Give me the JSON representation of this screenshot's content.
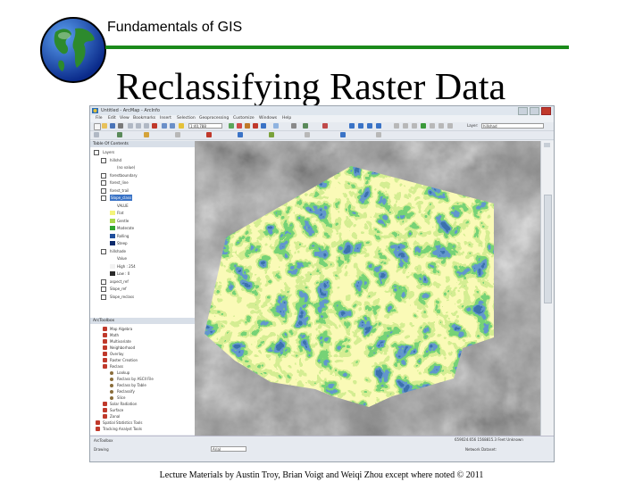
{
  "slide": {
    "course": "Fundamentals of GIS",
    "title": "Reclassifying Raster Data",
    "footer": "Lecture Materials by Austin Troy, Brian Voigt and Weiqi Zhou except where noted © 2011"
  },
  "app": {
    "window_title": "Untitled - ArcMap - ArcInfo",
    "menu": [
      "File",
      "Edit",
      "View",
      "Bookmarks",
      "Insert",
      "Selection",
      "Geoprocessing",
      "Customize",
      "Windows",
      "Help"
    ],
    "scale": "1:40,788",
    "layer_combo": "Layer:",
    "layer_value": "hillshad",
    "toc_title": "Table Of Contents",
    "toc": [
      {
        "label": "Layers",
        "type": "group"
      },
      {
        "label": "hillshd",
        "type": "layer"
      },
      {
        "label": "(no value)",
        "type": "legend-line"
      },
      {
        "label": "forestboundary",
        "type": "layer"
      },
      {
        "label": "forest_line",
        "type": "layer"
      },
      {
        "label": "forest_trail",
        "type": "layer"
      },
      {
        "label": "Slope_class",
        "type": "layer-selected"
      },
      {
        "label": "VALUE",
        "type": "legend-head"
      },
      {
        "label": "Flat",
        "type": "legend",
        "color": "#f4f47a"
      },
      {
        "label": "Gentle",
        "type": "legend",
        "color": "#a8d84a"
      },
      {
        "label": "Moderate",
        "type": "legend",
        "color": "#2fa52f"
      },
      {
        "label": "Rolling",
        "type": "legend",
        "color": "#1f4e9c"
      },
      {
        "label": "Steep",
        "type": "legend",
        "color": "#0c2a6b"
      },
      {
        "label": "hillshade",
        "type": "layer"
      },
      {
        "label": "Value",
        "type": "legend-head"
      },
      {
        "label": "High : 254",
        "type": "ramp-hi"
      },
      {
        "label": "Low : 0",
        "type": "ramp-lo"
      },
      {
        "label": "aspect_ref",
        "type": "layer"
      },
      {
        "label": "Slope_ref",
        "type": "layer"
      },
      {
        "label": "Slope_reclass",
        "type": "layer"
      }
    ],
    "toolbox_title": "ArcToolbox",
    "toolbox": [
      {
        "label": "Map Algebra",
        "level": 1
      },
      {
        "label": "Math",
        "level": 1
      },
      {
        "label": "Multivariate",
        "level": 1
      },
      {
        "label": "Neighborhood",
        "level": 1
      },
      {
        "label": "Overlay",
        "level": 1
      },
      {
        "label": "Raster Creation",
        "level": 1
      },
      {
        "label": "Reclass",
        "level": 1
      },
      {
        "label": "Lookup",
        "level": 2
      },
      {
        "label": "Reclass by ASCII File",
        "level": 2
      },
      {
        "label": "Reclass by Table",
        "level": 2
      },
      {
        "label": "Reclassify",
        "level": 2
      },
      {
        "label": "Slice",
        "level": 2
      },
      {
        "label": "Solar Radiation",
        "level": 1
      },
      {
        "label": "Surface",
        "level": 1
      },
      {
        "label": "Zonal",
        "level": 1
      },
      {
        "label": "Spatial Statistics Tools",
        "level": 0
      },
      {
        "label": "Tracking Analyst Tools",
        "level": 0
      }
    ],
    "status": {
      "coordinates": "659024.656 1568815.3 Feet Unknown",
      "drawing_label": "Drawing",
      "font_value": "Arial",
      "network": "Network Dataset:",
      "index_label": "ArcToolbox"
    },
    "colors": {
      "flat": "#f4f47a",
      "gentle": "#a8d84a",
      "moderate": "#2fa52f",
      "rolling": "#1f4e9c",
      "steep": "#0c2a6b"
    }
  }
}
